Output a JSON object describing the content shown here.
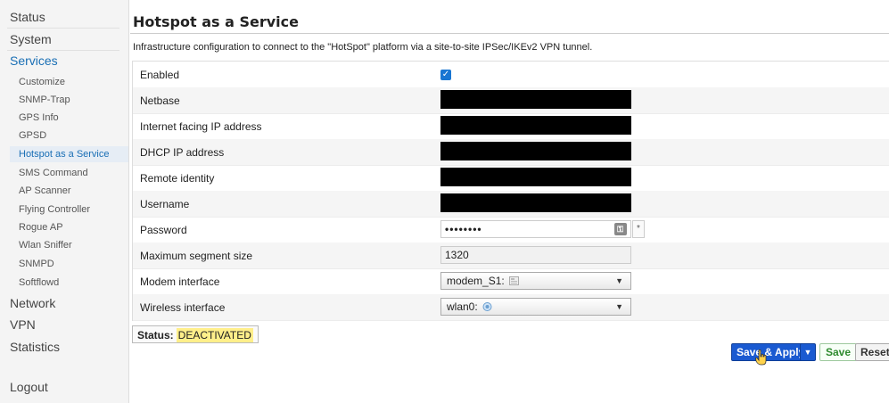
{
  "sidebar": {
    "top_items": [
      {
        "label": "Status"
      },
      {
        "label": "System"
      },
      {
        "label": "Services"
      }
    ],
    "services_items": [
      {
        "label": "Customize"
      },
      {
        "label": "SNMP-Trap"
      },
      {
        "label": "GPS Info"
      },
      {
        "label": "GPSD"
      },
      {
        "label": "Hotspot as a Service"
      },
      {
        "label": "SMS Command"
      },
      {
        "label": "AP Scanner"
      },
      {
        "label": "Flying Controller"
      },
      {
        "label": "Rogue AP"
      },
      {
        "label": "Wlan Sniffer"
      },
      {
        "label": "SNMPD"
      },
      {
        "label": "Softflowd"
      }
    ],
    "bottom_items": [
      {
        "label": "Network"
      },
      {
        "label": "VPN"
      },
      {
        "label": "Statistics"
      }
    ],
    "logout": "Logout",
    "active": "Hotspot as a Service"
  },
  "page": {
    "title": "Hotspot as a Service",
    "description": "Infrastructure configuration to connect to the \"HotSpot\" platform via a site-to-site IPSec/IKEv2 VPN tunnel."
  },
  "form": {
    "enabled": {
      "label": "Enabled",
      "checked": true,
      "check_glyph": "✓"
    },
    "netbase": {
      "label": "Netbase"
    },
    "internet_ip": {
      "label": "Internet facing IP address"
    },
    "dhcp_ip": {
      "label": "DHCP IP address"
    },
    "remote_identity": {
      "label": "Remote identity"
    },
    "username": {
      "label": "Username"
    },
    "password": {
      "label": "Password",
      "value": "••••••••",
      "reveal": "*"
    },
    "mss": {
      "label": "Maximum segment size",
      "value": "1320"
    },
    "modem_interface": {
      "label": "Modem interface",
      "value": "modem_S1:"
    },
    "wireless_interface": {
      "label": "Wireless interface",
      "value": "wlan0:"
    }
  },
  "status": {
    "label": "Status:",
    "value": "DEACTIVATED"
  },
  "actions": {
    "save_apply": "Save & Apply",
    "save": "Save",
    "reset": "Reset"
  },
  "colors": {
    "accent": "#1a6fb5",
    "primary_button": "#1a5ad1",
    "status_highlight": "#ffef8a"
  }
}
